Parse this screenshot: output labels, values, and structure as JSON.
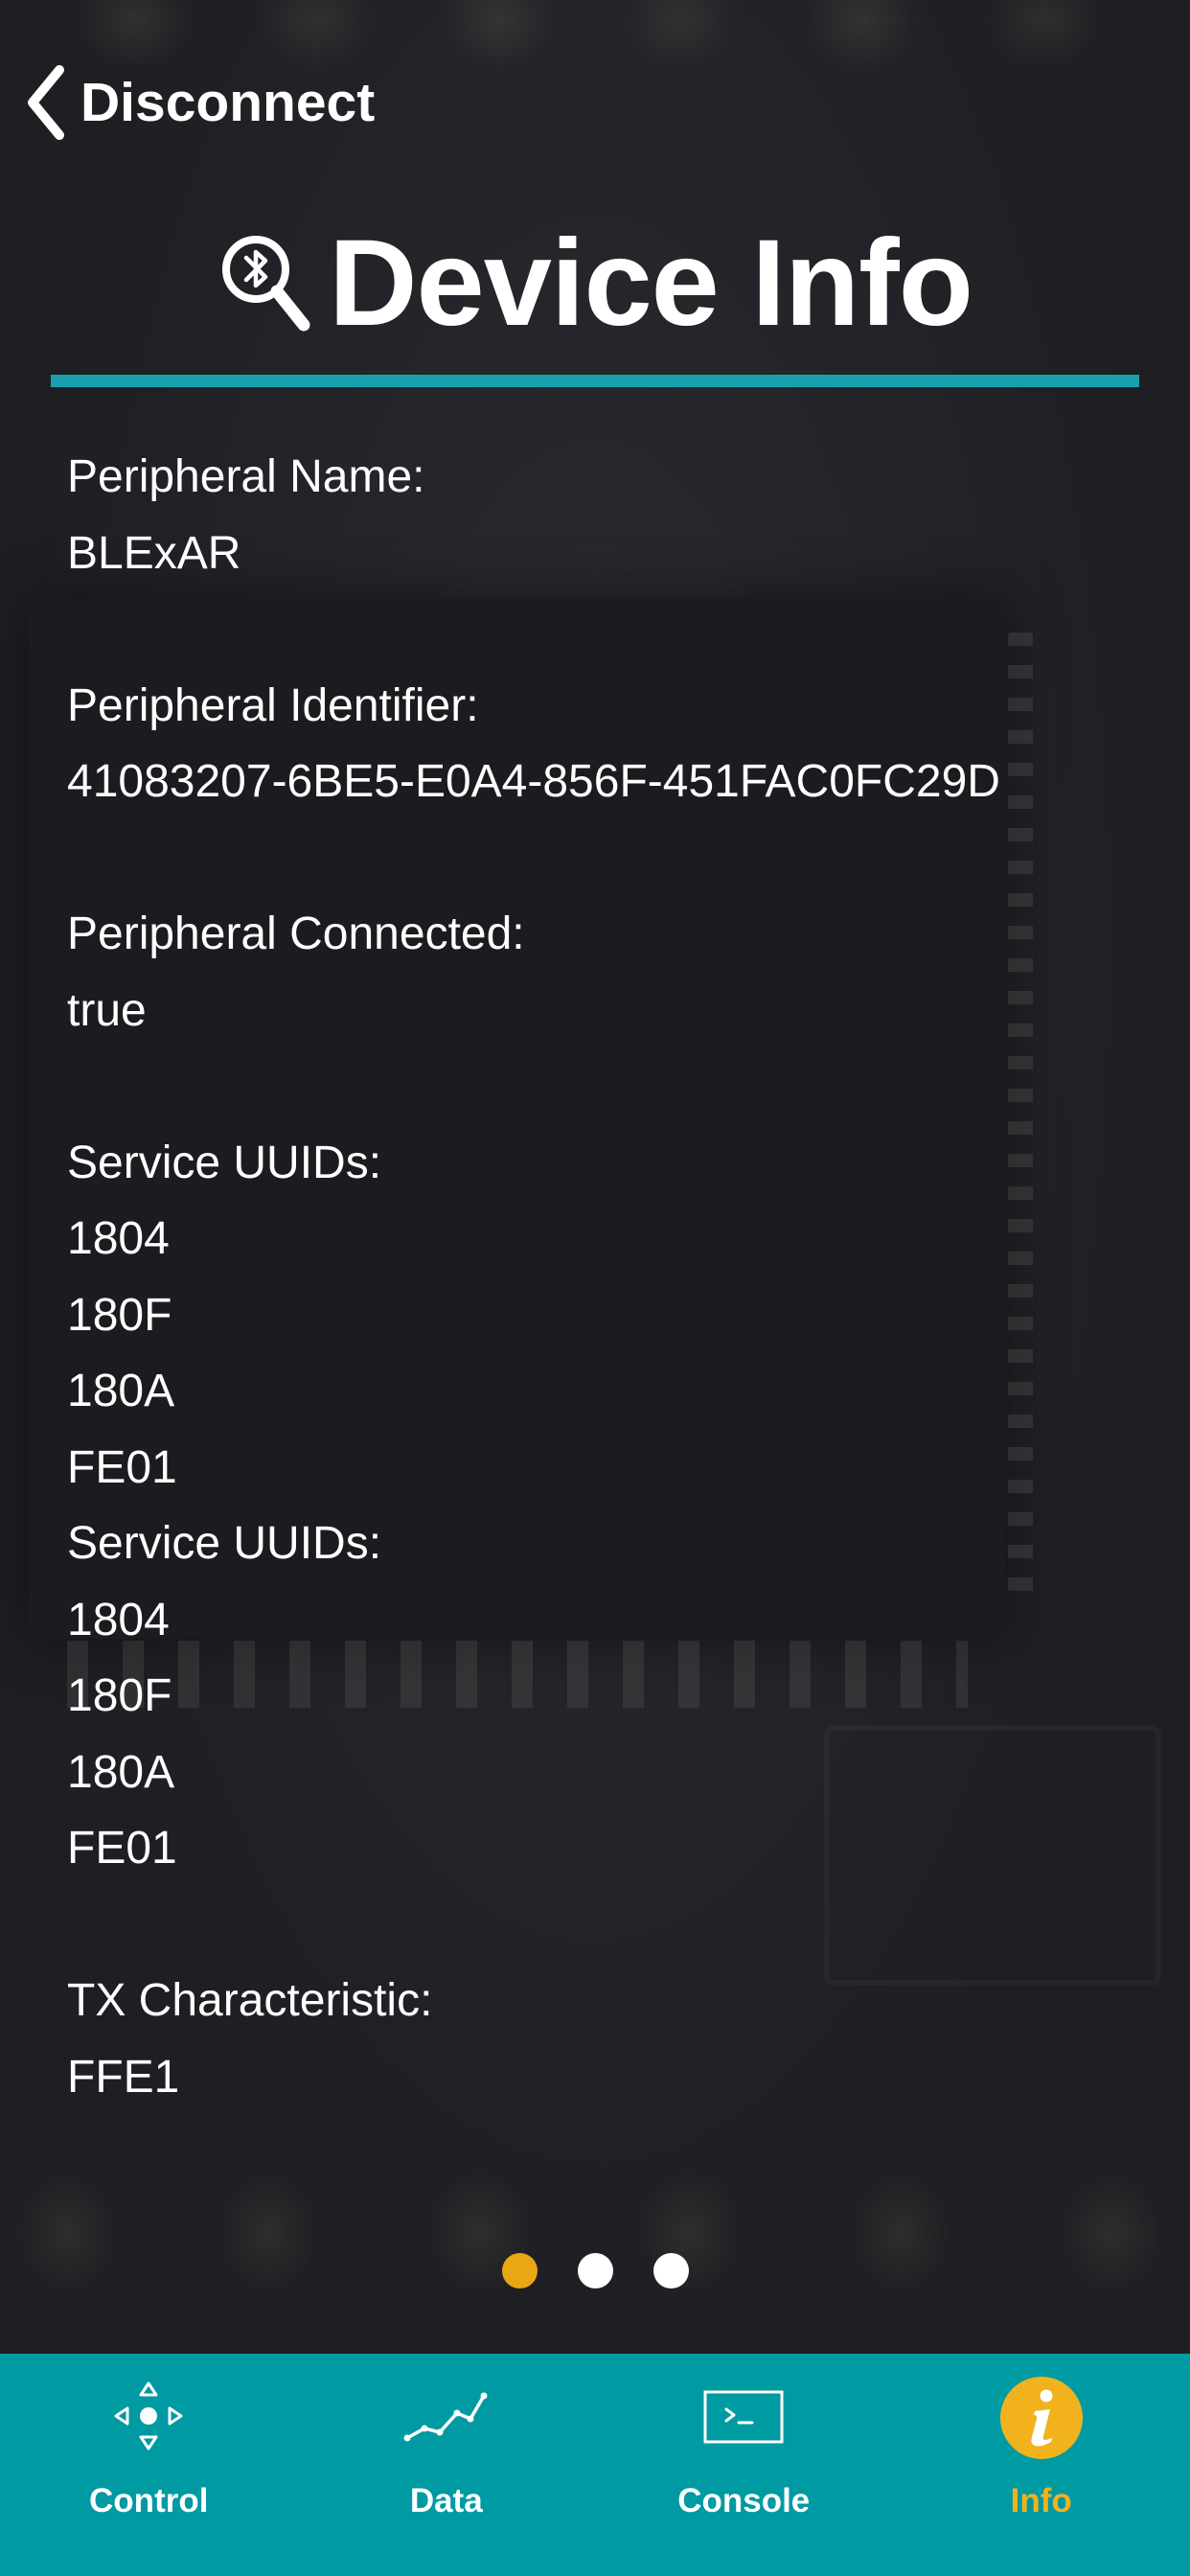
{
  "header": {
    "back_label": "Disconnect",
    "title": "Device Info"
  },
  "info": {
    "peripheral_name": {
      "label": "Peripheral Name:",
      "value": "BLExAR"
    },
    "peripheral_identifier": {
      "label": "Peripheral Identifier:",
      "value": "41083207-6BE5-E0A4-856F-451FAC0FC29D"
    },
    "peripheral_connected": {
      "label": "Peripheral Connected:",
      "value": "true"
    },
    "service_uuids_1": {
      "label": "Service UUIDs:",
      "values": [
        "1804",
        "180F",
        "180A",
        "FE01"
      ]
    },
    "service_uuids_2": {
      "label": "Service UUIDs:",
      "values": [
        "1804",
        "180F",
        "180A",
        "FE01"
      ]
    },
    "tx_characteristic": {
      "label": "TX Characteristic:",
      "value": "FFE1"
    }
  },
  "page_indicator": {
    "count": 3,
    "active_index": 0
  },
  "tabs": [
    {
      "label": "Control",
      "icon": "move-arrows-icon",
      "active": false
    },
    {
      "label": "Data",
      "icon": "line-chart-icon",
      "active": false
    },
    {
      "label": "Console",
      "icon": "terminal-icon",
      "active": false
    },
    {
      "label": "Info",
      "icon": "info-icon",
      "active": true
    }
  ],
  "colors": {
    "accent_teal": "#009aa2",
    "title_rule": "#17a2ad",
    "active_gold": "#f1b21d",
    "dot_active": "#eaa714",
    "text": "#ffffff"
  }
}
